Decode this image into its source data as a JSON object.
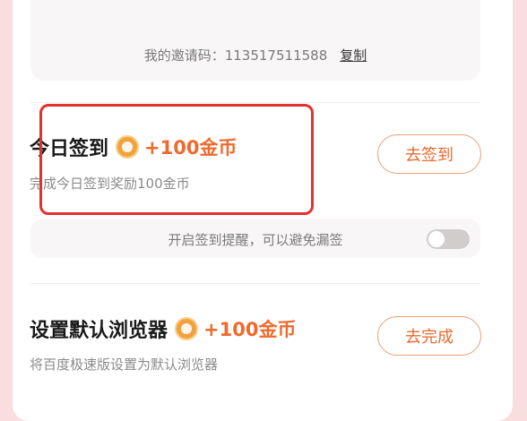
{
  "invite": {
    "label": "我的邀请码：113517511588",
    "copy": "复制"
  },
  "tasks": [
    {
      "title": "今日签到",
      "reward": "+100金币",
      "desc": "完成今日签到奖励100金币",
      "button": "去签到"
    },
    {
      "title": "设置默认浏览器",
      "reward": "+100金币",
      "desc": "将百度极速版设置为默认浏览器",
      "button": "去完成"
    }
  ],
  "reminder": {
    "text": "开启签到提醒，可以避免漏签",
    "enabled": false
  },
  "icons": {
    "coin": "coin-icon"
  },
  "colors": {
    "accent": "#ea6a2e",
    "highlight": "#e3312f",
    "background": "#f8dede"
  }
}
